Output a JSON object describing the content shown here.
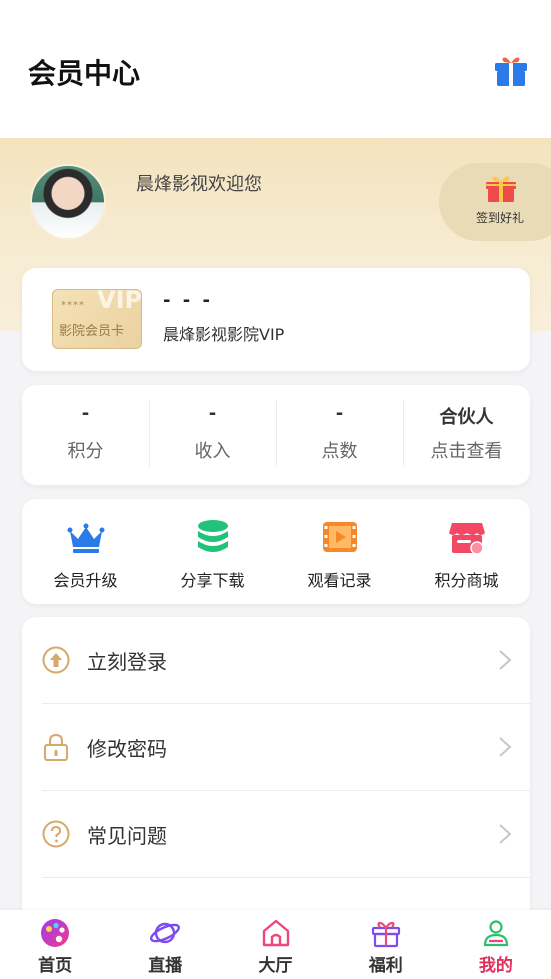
{
  "header": {
    "title": "会员中心",
    "gift_icon": "gift-icon"
  },
  "profile": {
    "welcome": "晨烽影视欢迎您",
    "signin_label": "签到好礼"
  },
  "vip_card": {
    "badge_stars": "****",
    "badge_watermark": "VIP",
    "badge_text": "影院会员卡",
    "dash": "- - -",
    "name": "晨烽影视影院VIP"
  },
  "stats": [
    {
      "value": "-",
      "label": "积分"
    },
    {
      "value": "-",
      "label": "收入"
    },
    {
      "value": "-",
      "label": "点数"
    },
    {
      "value": "合伙人",
      "label": "点击查看"
    }
  ],
  "menu": [
    {
      "label": "会员升级",
      "icon": "crown-icon"
    },
    {
      "label": "分享下载",
      "icon": "database-icon"
    },
    {
      "label": "观看记录",
      "icon": "film-icon"
    },
    {
      "label": "积分商城",
      "icon": "store-icon"
    }
  ],
  "list": [
    {
      "label": "立刻登录",
      "icon": "login-arrow-icon"
    },
    {
      "label": "修改密码",
      "icon": "lock-icon"
    },
    {
      "label": "常见问题",
      "icon": "question-icon"
    }
  ],
  "tabs": [
    {
      "label": "首页",
      "icon": "palette-icon"
    },
    {
      "label": "直播",
      "icon": "planet-icon"
    },
    {
      "label": "大厅",
      "icon": "home-icon"
    },
    {
      "label": "福利",
      "icon": "gift-icon"
    },
    {
      "label": "我的",
      "icon": "user-icon",
      "active": true
    }
  ],
  "colors": {
    "accent": "#e02f5b",
    "gold": "#f3e3bd",
    "blue": "#2a7be8"
  }
}
